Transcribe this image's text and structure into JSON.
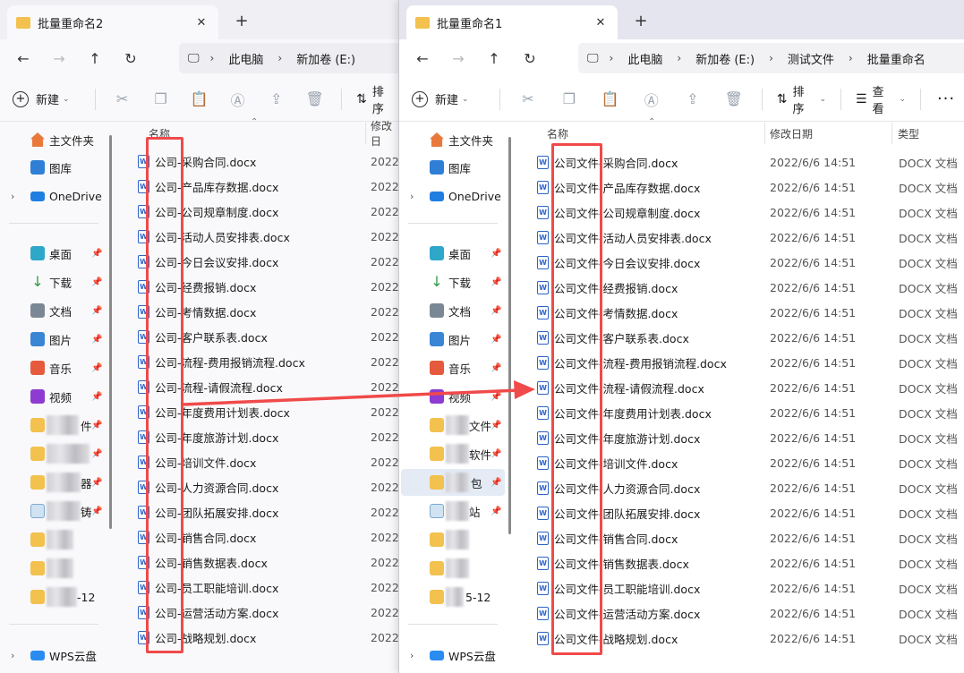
{
  "left_window": {
    "tab_title": "批量重命名2",
    "breadcrumbs": [
      "此电脑",
      "新加卷 (E:)"
    ],
    "command": {
      "new_label": "新建",
      "sort_label": "排序"
    },
    "column_headers": {
      "name": "名称",
      "modified": "修改日"
    },
    "sidebar": {
      "home": "主文件夹",
      "gallery": "图库",
      "onedrive": "OneDrive",
      "desktop": "桌面",
      "downloads": "下载",
      "documents": "文档",
      "pictures": "图片",
      "music": "音乐",
      "videos": "视频",
      "f1": "件",
      "f3": "器",
      "f4": "铸",
      "f7": "-12",
      "wps": "WPS云盘"
    },
    "files": [
      {
        "name": "公司-采购合同.docx",
        "date": "2022/"
      },
      {
        "name": "公司-产品库存数据.docx",
        "date": "2022/"
      },
      {
        "name": "公司-公司规章制度.docx",
        "date": "2022/"
      },
      {
        "name": "公司-活动人员安排表.docx",
        "date": "2022/"
      },
      {
        "name": "公司-今日会议安排.docx",
        "date": "2022/"
      },
      {
        "name": "公司-经费报销.docx",
        "date": "2022/"
      },
      {
        "name": "公司-考情数据.docx",
        "date": "2022/"
      },
      {
        "name": "公司-客户联系表.docx",
        "date": "2022/"
      },
      {
        "name": "公司-流程-费用报销流程.docx",
        "date": "2022/"
      },
      {
        "name": "公司-流程-请假流程.docx",
        "date": "2022/"
      },
      {
        "name": "公司-年度费用计划表.docx",
        "date": "2022/"
      },
      {
        "name": "公司-年度旅游计划.docx",
        "date": "2022/"
      },
      {
        "name": "公司-培训文件.docx",
        "date": "2022/"
      },
      {
        "name": "公司-人力资源合同.docx",
        "date": "2022/"
      },
      {
        "name": "公司-团队拓展安排.docx",
        "date": "2022/"
      },
      {
        "name": "公司-销售合同.docx",
        "date": "2022/"
      },
      {
        "name": "公司-销售数据表.docx",
        "date": "2022/"
      },
      {
        "name": "公司-员工职能培训.docx",
        "date": "2022/"
      },
      {
        "name": "公司-运营活动方案.docx",
        "date": "2022/"
      },
      {
        "name": "公司-战略规划.docx",
        "date": "2022/"
      }
    ]
  },
  "right_window": {
    "tab_title": "批量重命名1",
    "breadcrumbs": [
      "此电脑",
      "新加卷 (E:)",
      "测试文件",
      "批量重命名"
    ],
    "command": {
      "new_label": "新建",
      "sort_label": "排序",
      "view_label": "查看"
    },
    "column_headers": {
      "name": "名称",
      "modified": "修改日期",
      "type": "类型"
    },
    "sidebar": {
      "home": "主文件夹",
      "gallery": "图库",
      "onedrive": "OneDrive",
      "desktop": "桌面",
      "downloads": "下载",
      "documents": "文档",
      "pictures": "图片",
      "music": "音乐",
      "videos": "视频",
      "f1": "文件",
      "f2": "软件",
      "f3": "包",
      "f4": "站",
      "f7": "5-12",
      "wps": "WPS云盘"
    },
    "files": [
      {
        "name": "公司文件-采购合同.docx",
        "date": "2022/6/6 14:51",
        "type": "DOCX 文档"
      },
      {
        "name": "公司文件-产品库存数据.docx",
        "date": "2022/6/6 14:51",
        "type": "DOCX 文档"
      },
      {
        "name": "公司文件-公司规章制度.docx",
        "date": "2022/6/6 14:51",
        "type": "DOCX 文档"
      },
      {
        "name": "公司文件-活动人员安排表.docx",
        "date": "2022/6/6 14:51",
        "type": "DOCX 文档"
      },
      {
        "name": "公司文件-今日会议安排.docx",
        "date": "2022/6/6 14:51",
        "type": "DOCX 文档"
      },
      {
        "name": "公司文件-经费报销.docx",
        "date": "2022/6/6 14:51",
        "type": "DOCX 文档"
      },
      {
        "name": "公司文件-考情数据.docx",
        "date": "2022/6/6 14:51",
        "type": "DOCX 文档"
      },
      {
        "name": "公司文件-客户联系表.docx",
        "date": "2022/6/6 14:51",
        "type": "DOCX 文档"
      },
      {
        "name": "公司文件-流程-费用报销流程.docx",
        "date": "2022/6/6 14:51",
        "type": "DOCX 文档"
      },
      {
        "name": "公司文件-流程-请假流程.docx",
        "date": "2022/6/6 14:51",
        "type": "DOCX 文档"
      },
      {
        "name": "公司文件-年度费用计划表.docx",
        "date": "2022/6/6 14:51",
        "type": "DOCX 文档"
      },
      {
        "name": "公司文件-年度旅游计划.docx",
        "date": "2022/6/6 14:51",
        "type": "DOCX 文档"
      },
      {
        "name": "公司文件-培训文件.docx",
        "date": "2022/6/6 14:51",
        "type": "DOCX 文档"
      },
      {
        "name": "公司文件-人力资源合同.docx",
        "date": "2022/6/6 14:51",
        "type": "DOCX 文档"
      },
      {
        "name": "公司文件-团队拓展安排.docx",
        "date": "2022/6/6 14:51",
        "type": "DOCX 文档"
      },
      {
        "name": "公司文件-销售合同.docx",
        "date": "2022/6/6 14:51",
        "type": "DOCX 文档"
      },
      {
        "name": "公司文件-销售数据表.docx",
        "date": "2022/6/6 14:51",
        "type": "DOCX 文档"
      },
      {
        "name": "公司文件-员工职能培训.docx",
        "date": "2022/6/6 14:51",
        "type": "DOCX 文档"
      },
      {
        "name": "公司文件-运营活动方案.docx",
        "date": "2022/6/6 14:51",
        "type": "DOCX 文档"
      },
      {
        "name": "公司文件-战略规划.docx",
        "date": "2022/6/6 14:51",
        "type": "DOCX 文档"
      }
    ]
  },
  "icons": {
    "close": "close-icon",
    "add_tab": "plus-icon",
    "back": "arrow-left-icon",
    "forward": "arrow-right-icon",
    "up": "arrow-up-icon",
    "refresh": "refresh-icon",
    "computer": "computer-icon",
    "cut": "scissors-icon",
    "copy": "copy-icon",
    "paste": "clipboard-icon",
    "rename": "rename-icon",
    "share": "share-icon",
    "delete": "trash-icon",
    "sort": "sort-icon",
    "view": "view-icon",
    "more": "more-icon",
    "word_file": "word-document-icon",
    "pin": "pin-icon"
  },
  "colors": {
    "highlight": "#f04a4a",
    "word_blue": "#2b63c8",
    "folder_yellow": "#f2c14e",
    "selected_nav": "#e4ebf5"
  }
}
